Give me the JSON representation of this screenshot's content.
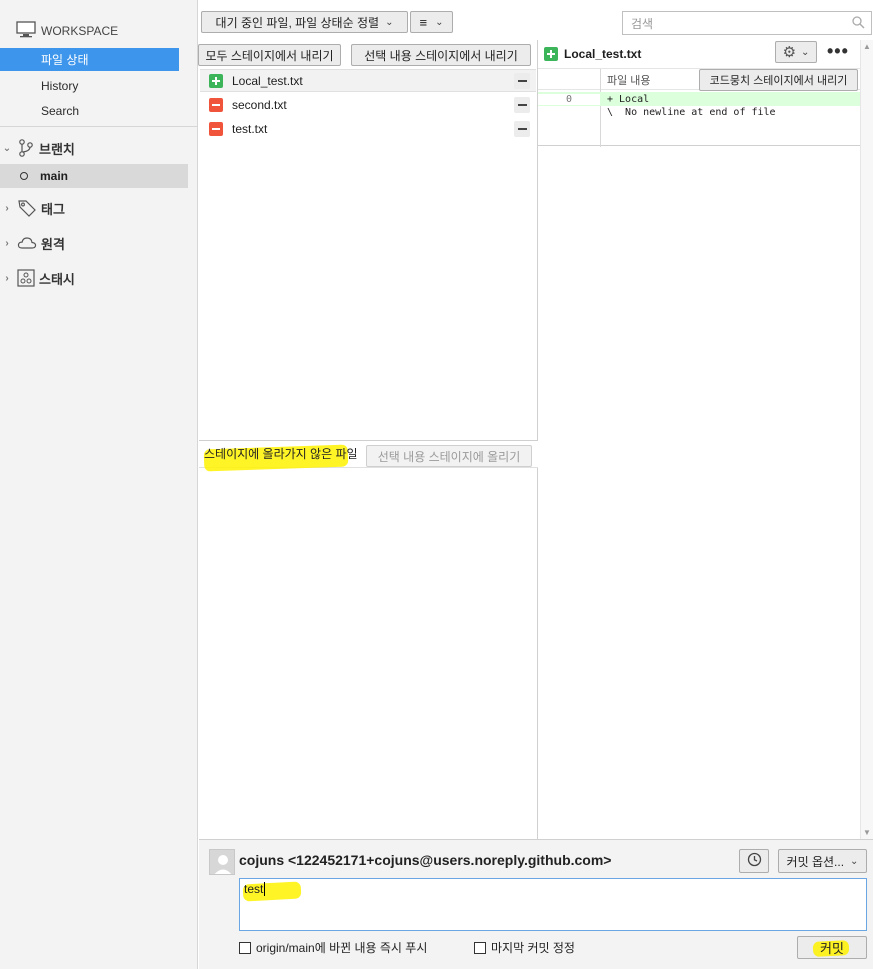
{
  "sidebar": {
    "workspace_label": "WORKSPACE",
    "items": [
      {
        "label": "파일 상태",
        "active": true
      },
      {
        "label": "History",
        "active": false
      },
      {
        "label": "Search",
        "active": false
      }
    ],
    "branches_label": "브랜치",
    "current_branch": "main",
    "tags_label": "태그",
    "remotes_label": "원격",
    "stashes_label": "스태시"
  },
  "toolbar": {
    "sort_label": "대기 중인 파일, 파일 상태순 정렬",
    "view_icon": "list-icon",
    "search_placeholder": "검색"
  },
  "staged": {
    "unstage_all_label": "모두 스테이지에서 내리기",
    "unstage_selected_label": "선택 내용 스테이지에서 내리기",
    "files": [
      {
        "name": "Local_test.txt",
        "status": "added"
      },
      {
        "name": "second.txt",
        "status": "removed"
      },
      {
        "name": "test.txt",
        "status": "removed"
      }
    ]
  },
  "unstaged": {
    "label": "스테이지에 올라가지 않은 파일",
    "stage_selected_label": "선택 내용 스테이지에 올리기",
    "files": []
  },
  "diff": {
    "file_name": "Local_test.txt",
    "hunk_title": "파일 내용",
    "unstage_hunk_label": "코드뭉치 스테이지에서 내리기",
    "lines": [
      {
        "num": "0",
        "text": "+ Local",
        "type": "add"
      },
      {
        "num": "",
        "text": "\\  No newline at end of file",
        "type": "context"
      }
    ]
  },
  "commit": {
    "author": "cojuns <122452171+cojuns@users.noreply.github.com>",
    "options_label": "커밋 옵션...",
    "message": "test",
    "push_label": "origin/main에 바뀐 내용 즉시 푸시",
    "amend_label": "마지막 커밋 정정",
    "commit_label": "커밋"
  },
  "colors": {
    "accent": "#3d95ec",
    "added": "#3cb45a",
    "removed": "#f0553c",
    "highlight": "#fff200"
  }
}
